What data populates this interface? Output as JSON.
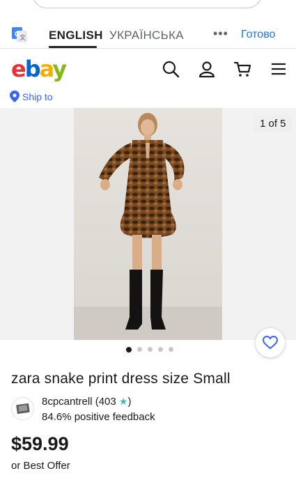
{
  "translate_bar": {
    "tab_english": "ENGLISH",
    "tab_ukrainian": "УКРАЇНСЬКА",
    "more_label": "•••",
    "done_label": "Готово"
  },
  "header": {
    "logo_letters": [
      "e",
      "b",
      "a",
      "y"
    ],
    "icons": [
      "search-icon",
      "user-icon",
      "cart-icon",
      "menu-icon"
    ],
    "ship_to_label": "Ship to"
  },
  "gallery": {
    "counter": "1 of 5",
    "total_images": 5,
    "active_index": 0
  },
  "listing": {
    "title": "zara snake print dress size Small",
    "seller_name": "8cpcantrell",
    "seller_count_prefix": " (403 ",
    "seller_count_suffix": ")",
    "seller_feedback": "84.6% positive feedback",
    "price": "$59.99",
    "offer_text": "or Best Offer"
  },
  "colors": {
    "ebay_red": "#e53238",
    "ebay_blue": "#0064d2",
    "ebay_yellow": "#f5af02",
    "ebay_green": "#86b817",
    "link_blue": "#3665f3",
    "google_blue": "#1a73e8"
  }
}
